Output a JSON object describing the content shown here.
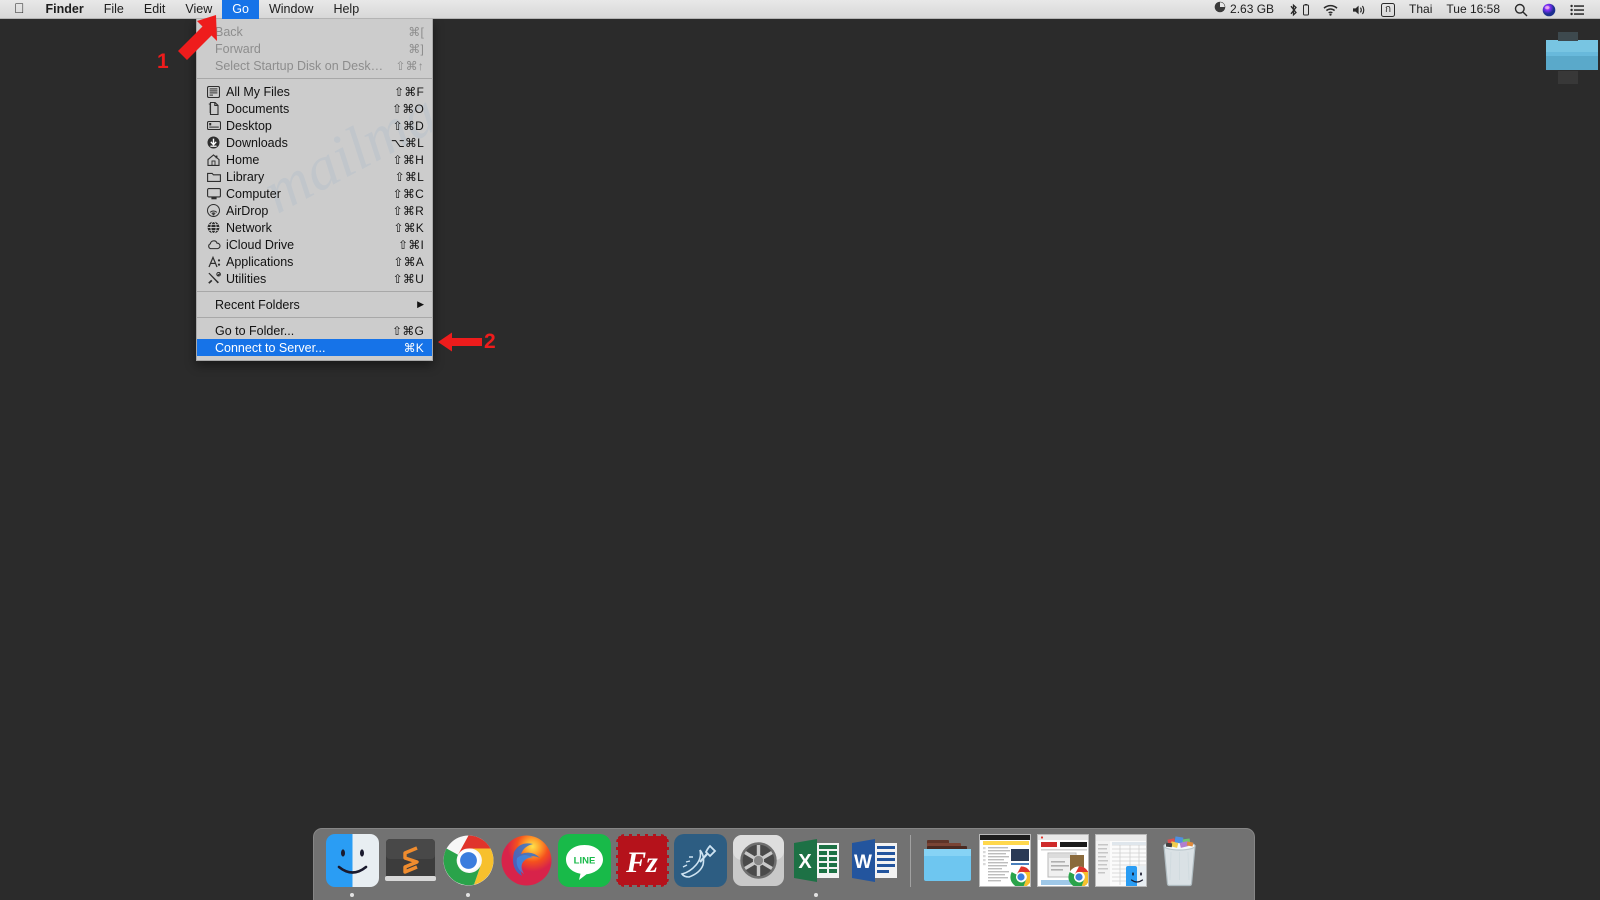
{
  "menubar": {
    "apple_icon": "apple-logo-icon",
    "apps": [
      {
        "label": "Finder",
        "bold": true,
        "active": false
      },
      {
        "label": "File",
        "bold": false,
        "active": false
      },
      {
        "label": "Edit",
        "bold": false,
        "active": false
      },
      {
        "label": "View",
        "bold": false,
        "active": false
      },
      {
        "label": "Go",
        "bold": false,
        "active": true
      },
      {
        "label": "Window",
        "bold": false,
        "active": false
      },
      {
        "label": "Help",
        "bold": false,
        "active": false
      }
    ],
    "status": {
      "memory": "2.63 GB",
      "input_source": "Thai",
      "input_glyph": "ก",
      "clock": "Tue 16:58",
      "icons": [
        "memory-clock-icon",
        "bluetooth-icon",
        "wifi-icon",
        "volume-icon",
        "thai-input-icon",
        "search-icon",
        "siri-icon",
        "control-center-icon"
      ]
    }
  },
  "go_menu": {
    "watermark": "mailmaster",
    "groups": [
      {
        "items": [
          {
            "label": "Back",
            "shortcut": "⌘[",
            "icon": null,
            "disabled": true,
            "selected": false
          },
          {
            "label": "Forward",
            "shortcut": "⌘]",
            "icon": null,
            "disabled": true,
            "selected": false
          },
          {
            "label": "Select Startup Disk on Desktop",
            "shortcut": "⇧⌘↑",
            "icon": null,
            "disabled": true,
            "selected": false
          }
        ]
      },
      {
        "items": [
          {
            "label": "All My Files",
            "shortcut": "⇧⌘F",
            "icon": "all-my-files-icon",
            "disabled": false,
            "selected": false
          },
          {
            "label": "Documents",
            "shortcut": "⇧⌘O",
            "icon": "documents-icon",
            "disabled": false,
            "selected": false
          },
          {
            "label": "Desktop",
            "shortcut": "⇧⌘D",
            "icon": "desktop-icon",
            "disabled": false,
            "selected": false
          },
          {
            "label": "Downloads",
            "shortcut": "⌥⌘L",
            "icon": "downloads-icon",
            "disabled": false,
            "selected": false
          },
          {
            "label": "Home",
            "shortcut": "⇧⌘H",
            "icon": "home-icon",
            "disabled": false,
            "selected": false
          },
          {
            "label": "Library",
            "shortcut": "⇧⌘L",
            "icon": "library-folder-icon",
            "disabled": false,
            "selected": false
          },
          {
            "label": "Computer",
            "shortcut": "⇧⌘C",
            "icon": "computer-icon",
            "disabled": false,
            "selected": false
          },
          {
            "label": "AirDrop",
            "shortcut": "⇧⌘R",
            "icon": "airdrop-icon",
            "disabled": false,
            "selected": false
          },
          {
            "label": "Network",
            "shortcut": "⇧⌘K",
            "icon": "network-globe-icon",
            "disabled": false,
            "selected": false
          },
          {
            "label": "iCloud Drive",
            "shortcut": "⇧⌘I",
            "icon": "icloud-drive-icon",
            "disabled": false,
            "selected": false
          },
          {
            "label": "Applications",
            "shortcut": "⇧⌘A",
            "icon": "applications-icon",
            "disabled": false,
            "selected": false
          },
          {
            "label": "Utilities",
            "shortcut": "⇧⌘U",
            "icon": "utilities-icon",
            "disabled": false,
            "selected": false
          }
        ]
      },
      {
        "items": [
          {
            "label": "Recent Folders",
            "shortcut": "",
            "icon": null,
            "disabled": false,
            "selected": false,
            "submenu": true
          }
        ]
      },
      {
        "items": [
          {
            "label": "Go to Folder...",
            "shortcut": "⇧⌘G",
            "icon": null,
            "disabled": false,
            "selected": false
          },
          {
            "label": "Connect to Server...",
            "shortcut": "⌘K",
            "icon": null,
            "disabled": false,
            "selected": true
          }
        ]
      }
    ]
  },
  "annotations": [
    {
      "number": "1",
      "target": "go-menu-title",
      "direction": "up-right"
    },
    {
      "number": "2",
      "target": "connect-to-server-item",
      "direction": "left"
    }
  ],
  "colors": {
    "desktop": "#2b2b2b",
    "menubar": "#e2e2e2",
    "menu_background": "#cccccc",
    "highlight": "#1673e8",
    "annotation_red": "#ee1c1c",
    "dock": "#777777"
  },
  "dock": {
    "apps": [
      {
        "name": "Finder",
        "icon": "finder-icon",
        "running": true
      },
      {
        "name": "Sublime Text",
        "icon": "sublime-text-icon",
        "running": false
      },
      {
        "name": "Google Chrome",
        "icon": "chrome-icon",
        "running": true
      },
      {
        "name": "Firefox",
        "icon": "firefox-icon",
        "running": false
      },
      {
        "name": "LINE",
        "icon": "line-icon",
        "running": false
      },
      {
        "name": "FileZilla",
        "icon": "filezilla-icon",
        "running": false
      },
      {
        "name": "MySQL Workbench",
        "icon": "mysql-workbench-icon",
        "running": false
      },
      {
        "name": "System Preferences",
        "icon": "system-preferences-icon",
        "running": false
      },
      {
        "name": "Microsoft Excel",
        "icon": "excel-icon",
        "running": true
      },
      {
        "name": "Microsoft Word",
        "icon": "word-icon",
        "running": false
      }
    ],
    "others": [
      {
        "name": "Downloads",
        "icon": "downloads-folder-icon"
      },
      {
        "name": "Minimized Window 1",
        "icon": "minimized-window-chrome-icon"
      },
      {
        "name": "Minimized Window 2",
        "icon": "minimized-window-chrome-icon"
      },
      {
        "name": "Minimized Window 3",
        "icon": "minimized-window-finder-icon"
      },
      {
        "name": "Trash",
        "icon": "trash-full-icon"
      }
    ]
  },
  "desktop": {
    "icon_name": "blue-folder-desktop-icon"
  }
}
